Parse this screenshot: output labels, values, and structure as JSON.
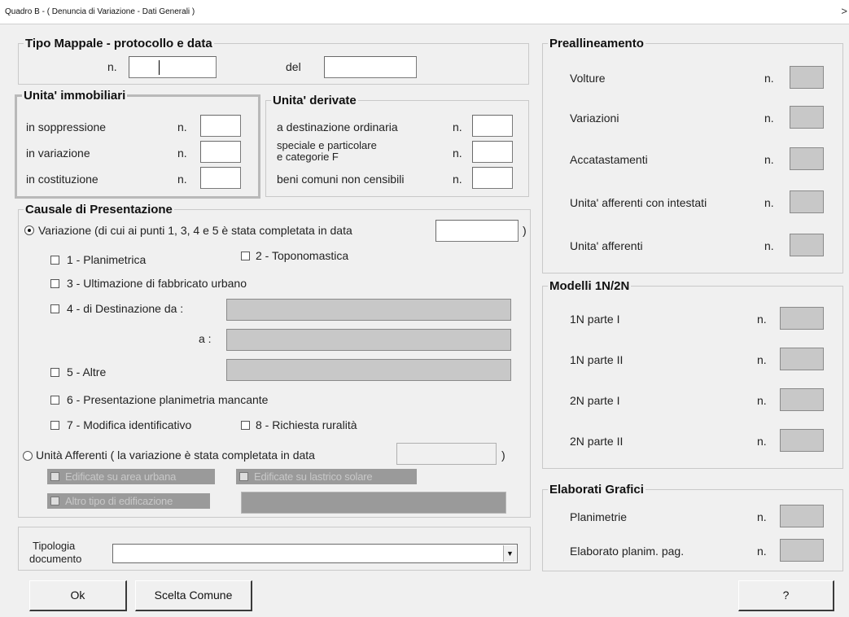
{
  "window": {
    "title": "Quadro B - ( Denuncia di Variazione - Dati Generali )",
    "close_glyph": ">"
  },
  "tipo_mappale": {
    "legend": "Tipo Mappale - protocollo e data",
    "n_label": "n.",
    "del_label": "del",
    "n_value": "",
    "del_value": ""
  },
  "unita_immobiliari": {
    "legend": "Unita' immobiliari",
    "rows": [
      {
        "label": "in soppressione",
        "n": "n."
      },
      {
        "label": "in variazione",
        "n": "n."
      },
      {
        "label": "in costituzione",
        "n": "n."
      }
    ]
  },
  "unita_derivate": {
    "legend": "Unita' derivate",
    "rows": [
      {
        "label": "a destinazione ordinaria",
        "n": "n."
      },
      {
        "label_line1": "speciale e particolare",
        "label_line2": "e categorie F",
        "n": "n."
      },
      {
        "label": "beni comuni non censibili",
        "n": "n."
      }
    ]
  },
  "causale": {
    "legend": "Causale di Presentazione",
    "variazione_radio": "Variazione (di cui ai punti 1, 3, 4 e 5 è stata completata in data",
    "variazione_close": ")",
    "checks": {
      "c1": "1 - Planimetrica",
      "c2": "2 - Toponomastica",
      "c3": "3 - Ultimazione di fabbricato urbano",
      "c4": "4 - di Destinazione da :",
      "c4a": "a :",
      "c5": "5 - Altre",
      "c6": "6 - Presentazione planimetria mancante",
      "c7": "7 - Modifica identificativo",
      "c8": "8 - Richiesta ruralità"
    },
    "afferenti_radio": "Unità Afferenti ( la variazione è stata completata in data",
    "afferenti_close": ")",
    "disabled": {
      "d1": "Edificate su area urbana",
      "d2": "Edificate su lastrico solare",
      "d3": "Altro tipo di edificazione"
    }
  },
  "tipologia": {
    "label_line1": "Tipologia",
    "label_line2": "documento",
    "value": ""
  },
  "buttons": {
    "ok": "Ok",
    "scelta": "Scelta Comune",
    "help": "?"
  },
  "preallineamento": {
    "legend": "Preallineamento",
    "rows": [
      {
        "label": "Volture",
        "n": "n."
      },
      {
        "label": "Variazioni",
        "n": "n."
      },
      {
        "label": "Accatastamenti",
        "n": "n."
      },
      {
        "label": "Unita' afferenti con intestati",
        "n": "n."
      },
      {
        "label": "Unita' afferenti",
        "n": "n."
      }
    ]
  },
  "modelli": {
    "legend": "Modelli 1N/2N",
    "rows": [
      {
        "label": "1N parte I",
        "n": "n."
      },
      {
        "label": "1N parte II",
        "n": "n."
      },
      {
        "label": "2N parte I",
        "n": "n."
      },
      {
        "label": "2N parte II",
        "n": "n."
      }
    ]
  },
  "elaborati": {
    "legend": "Elaborati Grafici",
    "rows": [
      {
        "label": "Planimetrie",
        "n": "n."
      },
      {
        "label": "Elaborato planim. pag.",
        "n": "n."
      }
    ]
  }
}
